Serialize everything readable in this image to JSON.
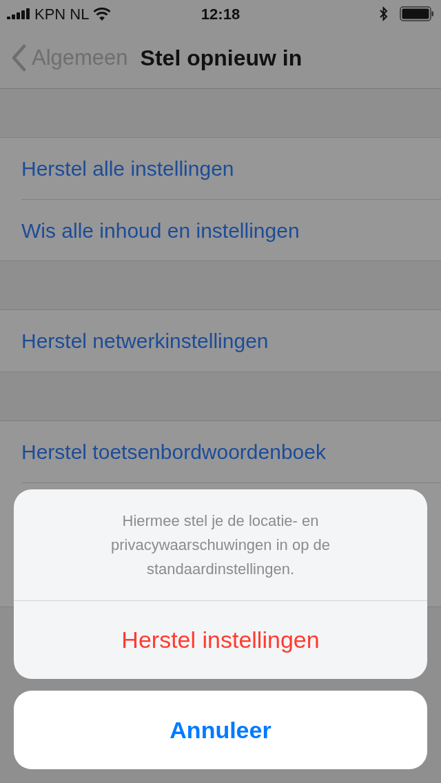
{
  "status_bar": {
    "carrier": "KPN NL",
    "time": "12:18"
  },
  "nav": {
    "back": "Algemeen",
    "title": "Stel opnieuw in"
  },
  "groups": [
    {
      "rows": [
        "Herstel alle instellingen",
        "Wis alle inhoud en instellingen"
      ]
    },
    {
      "rows": [
        "Herstel netwerkinstellingen"
      ]
    },
    {
      "rows": [
        "Herstel toetsenbordwoordenboek"
      ]
    }
  ],
  "action_sheet": {
    "message": "Hiermee stel je de locatie- en privacywaarschuwingen in op de standaardinstellingen.",
    "actions": [
      {
        "label": "Herstel instellingen",
        "kind": "destructive"
      }
    ],
    "cancel": "Annuleer"
  }
}
